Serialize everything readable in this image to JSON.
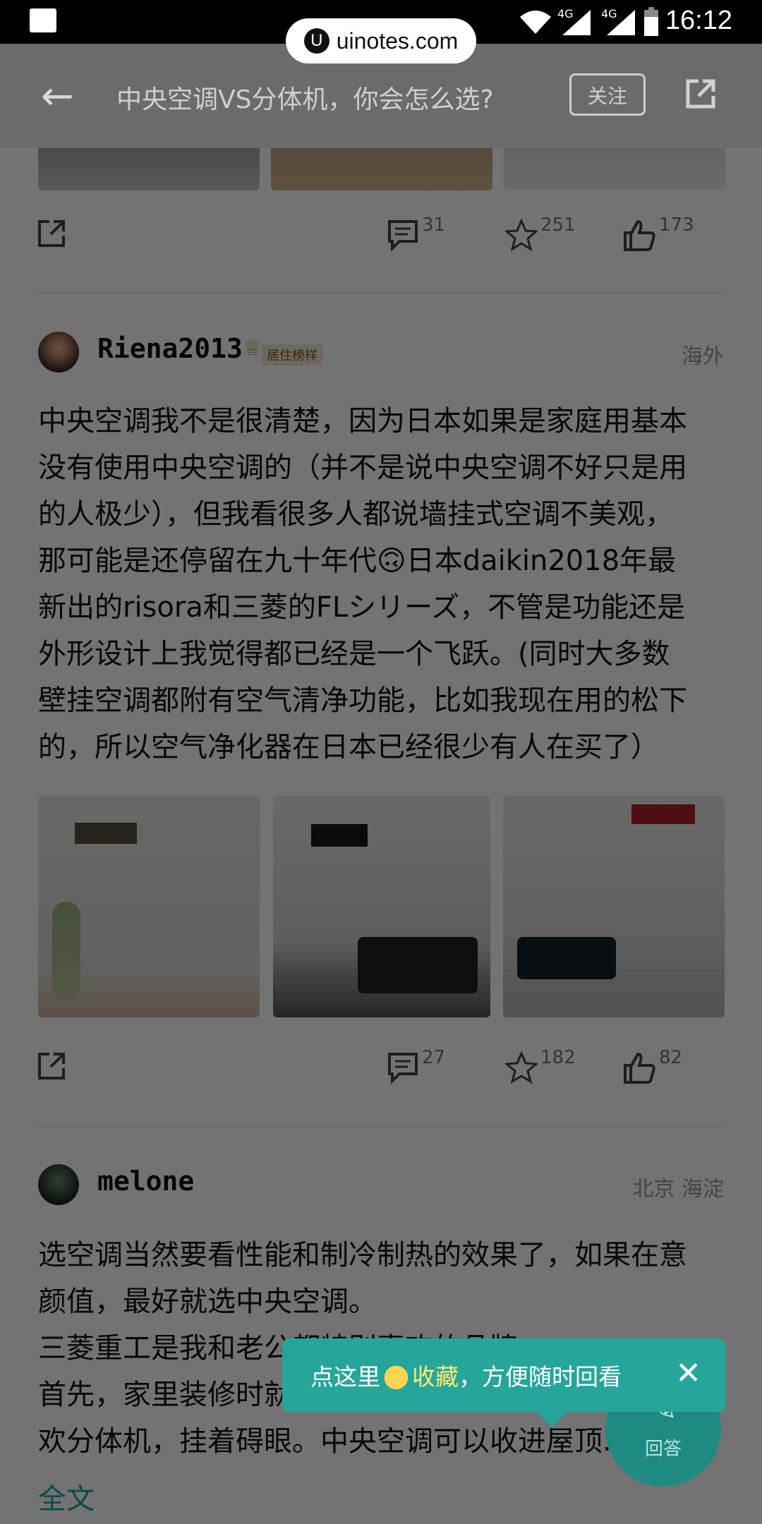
{
  "status_bar": {
    "time": "16:12",
    "net1": "4G",
    "net2": "4G"
  },
  "watermark": {
    "text": "uinotes.com",
    "logo": "U"
  },
  "header": {
    "title": "中央空调VS分体机，你会怎么选?",
    "follow_label": "关注"
  },
  "answer_prev": {
    "comments": "31",
    "favorites": "251",
    "likes": "173"
  },
  "answer_1": {
    "username": "Riena2013",
    "badge": "居住榜样",
    "location": "海外",
    "paragraph_lines": [
      "中央空调我不是很清楚，因为日本如果是家庭用基本",
      "没有使用中央空调的（并不是说中央空调不好只是用",
      "的人极少），但我看很多人都说墙挂式空调不美观，",
      "那可能是还停留在九十年代🙃日本daikin2018年最",
      "新出的risora和三菱的FLシリーズ，不管是功能还是",
      "外形设计上我觉得都已经是一个飞跃。(同时大多数",
      "壁挂空调都附有空气清净功能，比如我现在用的松下",
      "的，所以空气净化器在日本已经很少有人在买了）"
    ],
    "comments": "27",
    "favorites": "182",
    "likes": "82"
  },
  "answer_2": {
    "username": "melone",
    "location": "北京 海淀",
    "paragraph_lines": [
      "选空调当然要看性能和制冷制热的效果了，如果在意",
      "颜值，最好就选中央空调。",
      "三菱重工是我和老公都特别喜欢的品牌",
      "首先，家里装修时就",
      "欢分体机，挂着碍眼。中央空调可以收进屋顶..."
    ],
    "more_label": "全文"
  },
  "tooltip": {
    "text_prefix": "点这里",
    "highlight": "收藏",
    "text_suffix": "，方便随时回看"
  },
  "fab": {
    "label": "回答"
  },
  "colors": {
    "accent": "#26a69a",
    "link": "#1aa6a0",
    "highlight": "#ffe873"
  }
}
